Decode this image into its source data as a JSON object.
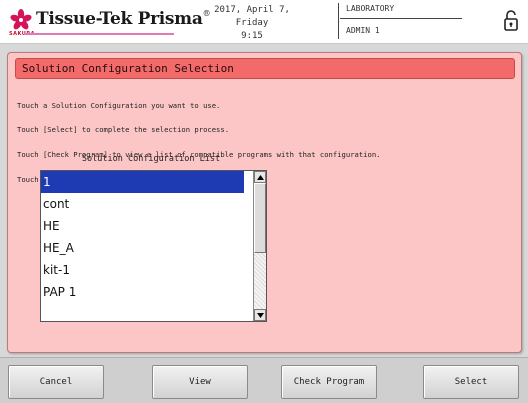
{
  "header": {
    "brand": "Tissue-Tek Prisma",
    "brand_mark": "®",
    "sakura_text": "SAKURA",
    "date": "2017, April 7, Friday",
    "time": "9:15",
    "location": "LABORATORY",
    "user": "ADMIN 1"
  },
  "panel": {
    "title": "Solution Configuration Selection",
    "instructions": [
      "Touch a Solution Configuration you want to use.",
      "Touch [Select] to complete the selection process.",
      "Touch [Check Program] to view a list of compatible programs with that configuration.",
      "Touch [View] to view the selected Solution Configuration."
    ],
    "list_caption": "Solution Configuration List",
    "list_items": [
      "1",
      "cont",
      "HE",
      "HE_A",
      "kit-1",
      "PAP 1"
    ],
    "selected_index": 0
  },
  "buttons": {
    "cancel": "Cancel",
    "view": "View",
    "check_program": "Check Program",
    "select": "Select"
  },
  "colors": {
    "panel_bg": "#fdc6c6",
    "title_bar": "#f36a6a",
    "selection": "#1e3bb3"
  }
}
